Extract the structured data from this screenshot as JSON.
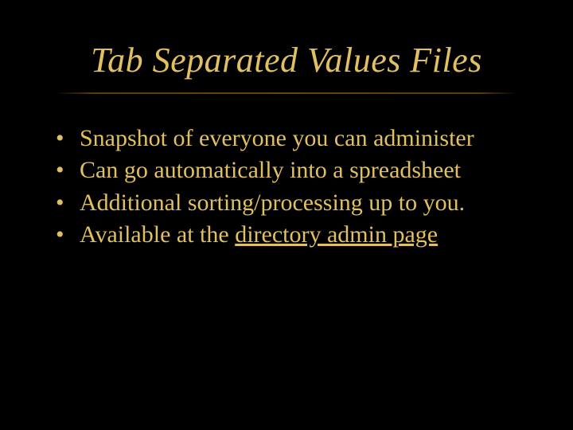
{
  "title": "Tab Separated Values Files",
  "bullets": [
    {
      "text": "Snapshot of everyone you can administer"
    },
    {
      "text": "Can go automatically into a spreadsheet"
    },
    {
      "text": "Additional sorting/processing up to you."
    },
    {
      "prefix": "Available at the ",
      "link": "directory admin page"
    }
  ],
  "dot": "•"
}
